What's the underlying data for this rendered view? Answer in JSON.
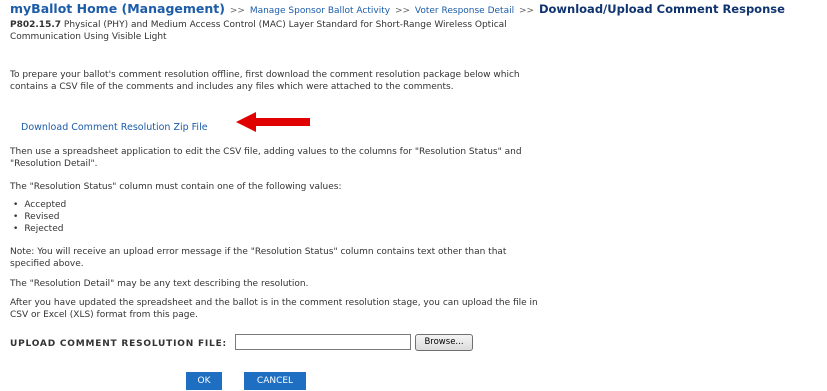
{
  "breadcrumb": {
    "home": "myBallot Home (Management)",
    "separator": ">>",
    "links": [
      "Manage Sponsor Ballot Activity",
      "Voter Response Detail"
    ],
    "current": "Download/Upload Comment Response"
  },
  "project": {
    "id": "P802.15.7",
    "title": "Physical (PHY) and Medium Access Control (MAC) Layer Standard for Short-Range Wireless Optical Communication Using Visible Light"
  },
  "instructions": {
    "intro": "To prepare your ballot's comment resolution offline, first download the comment resolution package below which contains a CSV file of the comments and includes any files which were attached to the comments.",
    "download_link": "Download Comment Resolution Zip File",
    "edit_csv": "Then use a spreadsheet application to edit the CSV file, adding values to the columns for \"Resolution Status\" and \"Resolution Detail\".",
    "status_rule": "The \"Resolution Status\" column must contain one of the following values:",
    "status_values": [
      "Accepted",
      "Revised",
      "Rejected"
    ],
    "note": "Note: You will receive an upload error message if the \"Resolution Status\" column contains text other than that specified above.",
    "detail_rule": "The \"Resolution Detail\" may be any text describing the resolution.",
    "upload_hint": "After you have updated the spreadsheet and the ballot is in the comment resolution stage, you can upload the file in CSV or Excel (XLS) format from this page."
  },
  "upload": {
    "label": "UPLOAD COMMENT RESOLUTION FILE:",
    "file_value": "",
    "browse_label": "Browse..."
  },
  "actions": {
    "ok_label": "OK",
    "cancel_label": "CANCEL"
  },
  "colors": {
    "link": "#1c5ca8",
    "button": "#1e6fc1",
    "annotation_arrow": "#e00000"
  }
}
